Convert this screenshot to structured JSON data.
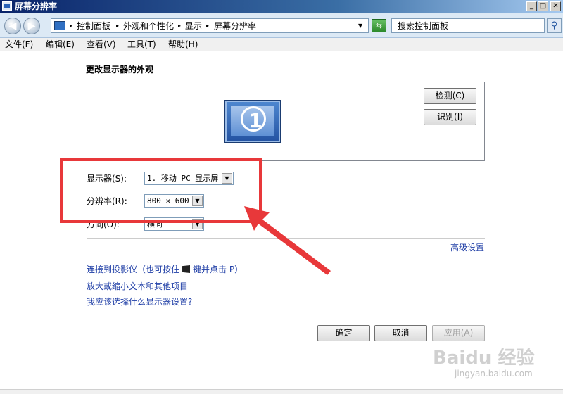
{
  "window": {
    "title": "屏幕分辨率",
    "controls": {
      "minimize": "_",
      "maximize": "□",
      "close": "✕"
    }
  },
  "address_bar": {
    "breadcrumbs": [
      "控制面板",
      "外观和个性化",
      "显示",
      "屏幕分辨率"
    ],
    "search_placeholder": "搜索控制面板"
  },
  "menu": [
    "文件(F)",
    "编辑(E)",
    "查看(V)",
    "工具(T)",
    "帮助(H)"
  ],
  "main": {
    "heading": "更改显示器的外观",
    "monitor_number": "1",
    "detect_label": "检测(C)",
    "identify_label": "识别(I)",
    "display_label": "显示器(S):",
    "display_value": "1. 移动 PC 显示屏",
    "resolution_label": "分辨率(R):",
    "resolution_value": "800 × 600",
    "orientation_label": "方向(O):",
    "orientation_value": "横向",
    "advanced_link": "高级设置",
    "links": {
      "projector_a": "连接到投影仪（也可按住",
      "projector_b": "键并点击 P）",
      "text_size": "放大或缩小文本和其他项目",
      "which_settings": "我应该选择什么显示器设置?"
    },
    "buttons": {
      "ok": "确定",
      "cancel": "取消",
      "apply": "应用(A)"
    }
  },
  "annotation": {
    "color": "#e8383a"
  },
  "watermark": {
    "logo": "Baidu 经验",
    "url": "jingyan.baidu.com"
  }
}
